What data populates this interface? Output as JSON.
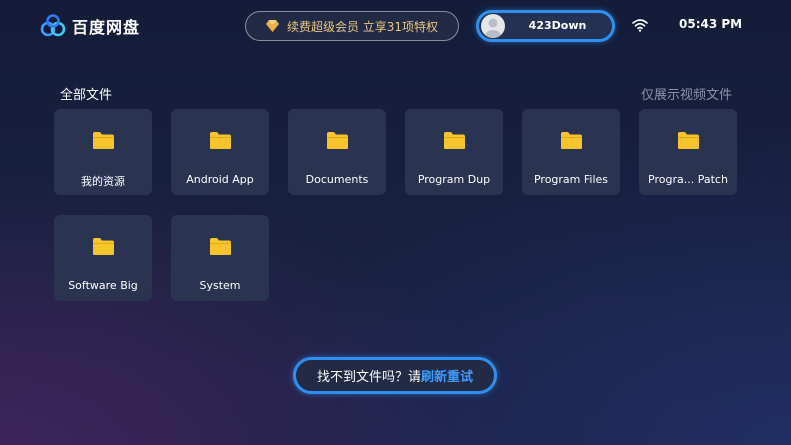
{
  "header": {
    "app_title": "百度网盘",
    "vip_banner": "续费超级会员 立享31项特权",
    "user_name": "423Down",
    "time": "05:43 PM"
  },
  "section": {
    "title": "全部文件",
    "filter_link": "仅展示视频文件"
  },
  "folders": [
    {
      "label": "我的资源"
    },
    {
      "label": "Android App"
    },
    {
      "label": "Documents"
    },
    {
      "label": "Program Dup"
    },
    {
      "label": "Program Files"
    },
    {
      "label": "Progra... Patch"
    },
    {
      "label": "Software Big"
    },
    {
      "label": "System"
    }
  ],
  "footer": {
    "refresh_prefix": "找不到文件吗？请",
    "refresh_action": "刷新重试"
  },
  "colors": {
    "accent_blue": "#2f8ff0",
    "folder_yellow": "#f7c52b",
    "vip_gold": "#e9c880",
    "tile_bg": "#2a3350"
  },
  "icons": {
    "logo": "baidu-netdisk-logo-icon",
    "vip": "diamond-icon",
    "avatar": "user-avatar-icon",
    "status": "wifi-icon",
    "folder": "folder-icon"
  }
}
